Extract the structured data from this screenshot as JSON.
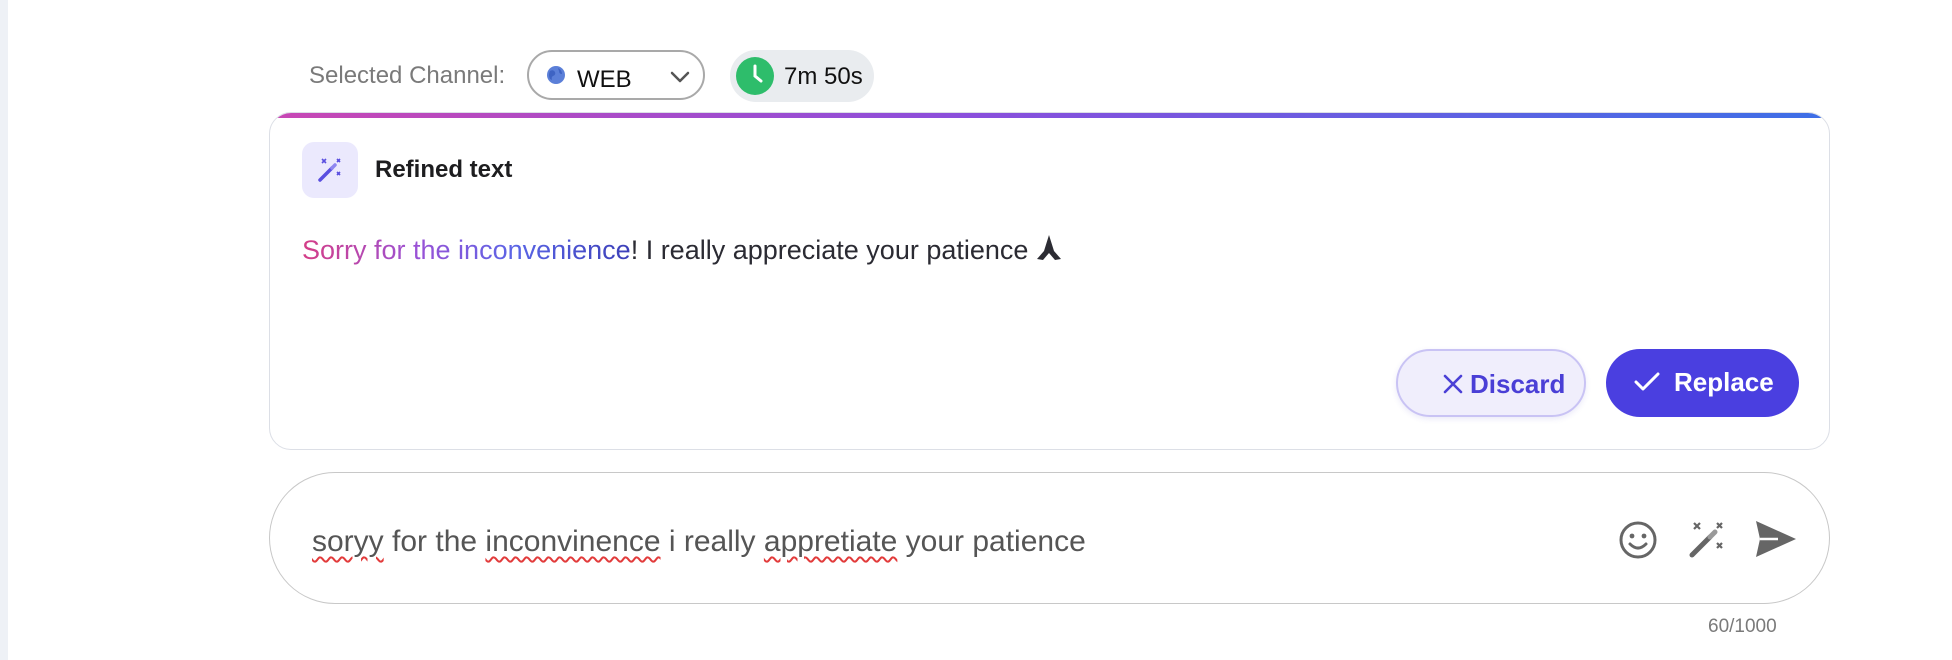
{
  "channel": {
    "label": "Selected Channel:",
    "selected": "WEB",
    "icon": "globe-icon"
  },
  "timer": {
    "value": "7m 50s",
    "icon": "clock-icon",
    "color": "#2ebd6b"
  },
  "refined_card": {
    "title": "Refined text",
    "icon": "magic-wand-icon",
    "text_highlight": "Sorry for the inconvenience",
    "text_rest": "! I really appreciate your patience",
    "emoji": "folded-hands-icon",
    "discard_label": "Discard",
    "replace_label": "Replace",
    "accent_color": "#4a3fe0"
  },
  "composer": {
    "words": [
      {
        "text": "soryy",
        "typo": true
      },
      {
        "text": " for the ",
        "typo": false
      },
      {
        "text": "inconvinence",
        "typo": true
      },
      {
        "text": " i really ",
        "typo": false
      },
      {
        "text": "appretiate",
        "typo": true
      },
      {
        "text": " your patience",
        "typo": false
      }
    ],
    "char_count": "60/1000",
    "icons": [
      "smiley-icon",
      "magic-wand-icon",
      "send-icon"
    ]
  }
}
